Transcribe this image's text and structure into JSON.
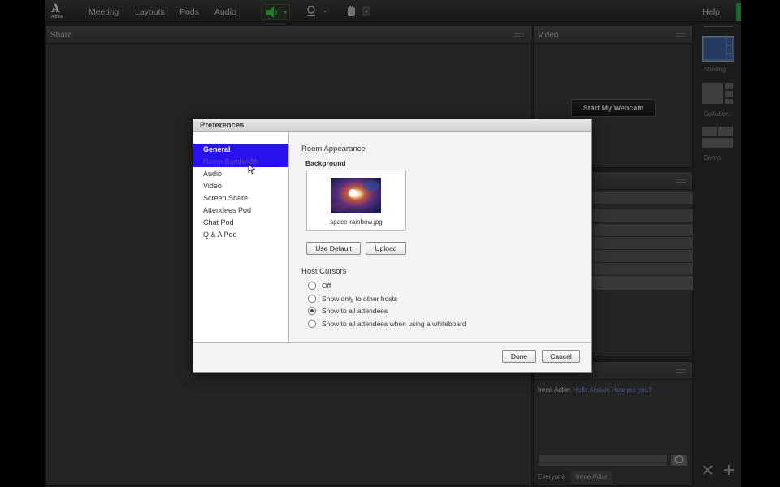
{
  "menubar": {
    "logo_text": "Adobe",
    "items": [
      "Meeting",
      "Layouts",
      "Pods",
      "Audio"
    ],
    "help": "Help",
    "icons": [
      "speaker-icon",
      "webcam-icon",
      "raise-hand-icon"
    ]
  },
  "pods": {
    "share_title": "Share",
    "video_title": "Video",
    "webcam_button": "Start My Webcam",
    "chat": {
      "sender": "Irene Adler",
      "message": "Hello Alistair, How are you?",
      "tabs": [
        "Everyone",
        "Irene Adler"
      ]
    }
  },
  "layouts": [
    "Sharing",
    "Collabor...",
    "Demo"
  ],
  "dialog": {
    "title": "Preferences",
    "nav": [
      "General",
      "Room Bandwidth",
      "Audio",
      "Video",
      "Screen Share",
      "Attendees Pod",
      "Chat Pod",
      "Q & A Pod"
    ],
    "selected_nav": "General",
    "room_appearance": "Room Appearance",
    "background_label": "Background",
    "background_file": "space-rainbow.jpg",
    "use_default_button": "Use Default",
    "upload_button": "Upload",
    "host_cursors_label": "Host Cursors",
    "cursor_options": [
      "Off",
      "Show only to other hosts",
      "Show to all attendees",
      "Show to all attendees when using a whiteboard"
    ],
    "selected_cursor_option": "Show to all attendees",
    "done_button": "Done",
    "cancel_button": "Cancel"
  },
  "colors": {
    "nav_selected": "#2a12f0",
    "chat_message": "#7d8fd8",
    "status_green": "#2aa53c"
  }
}
